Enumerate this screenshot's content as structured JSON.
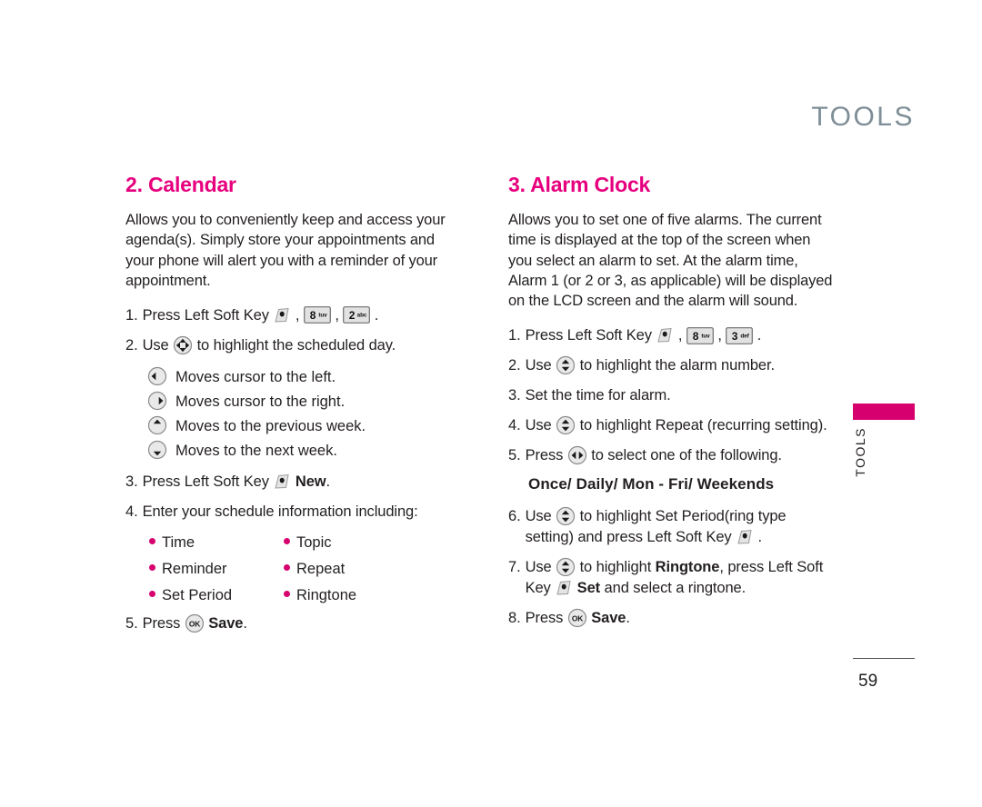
{
  "header": {
    "title": "TOOLS"
  },
  "side_tab": {
    "label": "TOOLS",
    "color": "#d6006e"
  },
  "footer": {
    "page_number": "59"
  },
  "colors": {
    "heading": "#e6007e",
    "bullet": "#d6006e",
    "header_text": "#7d8e96"
  },
  "left_column": {
    "title": "2. Calendar",
    "intro": "Allows you to conveniently keep and access your agenda(s). Simply store your appointments and your phone will alert you with a reminder of your appointment.",
    "steps": [
      {
        "num": "1.",
        "parts": [
          {
            "type": "text",
            "value": "Press Left Soft Key "
          },
          {
            "type": "icon",
            "icon": "soft-key-icon"
          },
          {
            "type": "text",
            "value": " , "
          },
          {
            "type": "key",
            "digit": "8",
            "letters": "tuv"
          },
          {
            "type": "text",
            "value": " , "
          },
          {
            "type": "key",
            "digit": "2",
            "letters": "abc"
          },
          {
            "type": "text",
            "value": " ."
          }
        ]
      },
      {
        "num": "2.",
        "parts": [
          {
            "type": "text",
            "value": "Use "
          },
          {
            "type": "icon",
            "icon": "nav-4way-icon"
          },
          {
            "type": "text",
            "value": " to highlight the scheduled day."
          }
        ]
      }
    ],
    "nav_list": [
      {
        "icon": "nav-left-icon",
        "label": "Moves cursor to the left."
      },
      {
        "icon": "nav-right-icon",
        "label": "Moves cursor to the right."
      },
      {
        "icon": "nav-up-icon",
        "label": "Moves to the previous week."
      },
      {
        "icon": "nav-down-icon",
        "label": "Moves to the next week."
      }
    ],
    "step3": {
      "num": "3.",
      "parts": [
        {
          "type": "text",
          "value": "Press Left Soft Key "
        },
        {
          "type": "icon",
          "icon": "soft-key-icon"
        },
        {
          "type": "text",
          "value": " "
        },
        {
          "type": "bold",
          "value": "New"
        },
        {
          "type": "text",
          "value": "."
        }
      ]
    },
    "step4": {
      "num": "4.",
      "parts": [
        {
          "type": "text",
          "value": "Enter your schedule information including:"
        }
      ]
    },
    "bullets": [
      "Time",
      "Topic",
      "Reminder",
      "Repeat",
      "Set Period",
      "Ringtone"
    ],
    "step5": {
      "num": "5.",
      "parts": [
        {
          "type": "text",
          "value": "Press "
        },
        {
          "type": "icon",
          "icon": "ok-key-icon"
        },
        {
          "type": "text",
          "value": " "
        },
        {
          "type": "bold",
          "value": "Save"
        },
        {
          "type": "text",
          "value": "."
        }
      ]
    }
  },
  "right_column": {
    "title": "3. Alarm Clock",
    "intro": "Allows you to set one of five alarms. The current time is displayed at the top of the screen when you select an alarm to set. At the alarm time, Alarm 1 (or 2 or 3, as applicable) will be displayed on the LCD screen and the alarm will sound.",
    "emphasis_line": "Once/ Daily/ Mon - Fri/ Weekends",
    "steps": [
      {
        "num": "1.",
        "parts": [
          {
            "type": "text",
            "value": "Press Left Soft Key "
          },
          {
            "type": "icon",
            "icon": "soft-key-icon"
          },
          {
            "type": "text",
            "value": " , "
          },
          {
            "type": "key",
            "digit": "8",
            "letters": "tuv"
          },
          {
            "type": "text",
            "value": " , "
          },
          {
            "type": "key",
            "digit": "3",
            "letters": "def"
          },
          {
            "type": "text",
            "value": " ."
          }
        ]
      },
      {
        "num": "2.",
        "parts": [
          {
            "type": "text",
            "value": "Use "
          },
          {
            "type": "icon",
            "icon": "nav-updown-icon"
          },
          {
            "type": "text",
            "value": " to highlight the alarm number."
          }
        ]
      },
      {
        "num": "3.",
        "parts": [
          {
            "type": "text",
            "value": "Set the time for alarm."
          }
        ]
      },
      {
        "num": "4.",
        "parts": [
          {
            "type": "text",
            "value": "Use "
          },
          {
            "type": "icon",
            "icon": "nav-updown-icon"
          },
          {
            "type": "text",
            "value": " to highlight Repeat (recurring setting)."
          }
        ]
      },
      {
        "num": "5.",
        "parts": [
          {
            "type": "text",
            "value": "Press "
          },
          {
            "type": "icon",
            "icon": "nav-leftright-icon"
          },
          {
            "type": "text",
            "value": " to select one of the following."
          }
        ]
      }
    ],
    "steps_after": [
      {
        "num": "6.",
        "parts": [
          {
            "type": "text",
            "value": "Use "
          },
          {
            "type": "icon",
            "icon": "nav-updown-icon"
          },
          {
            "type": "text",
            "value": " to highlight Set Period(ring type setting) and press Left Soft Key "
          },
          {
            "type": "icon",
            "icon": "soft-key-icon"
          },
          {
            "type": "text",
            "value": " ."
          }
        ]
      },
      {
        "num": "7.",
        "parts": [
          {
            "type": "text",
            "value": "Use "
          },
          {
            "type": "icon",
            "icon": "nav-updown-icon"
          },
          {
            "type": "text",
            "value": " to highlight "
          },
          {
            "type": "bold",
            "value": "Ringtone"
          },
          {
            "type": "text",
            "value": ", press Left Soft Key "
          },
          {
            "type": "icon",
            "icon": "soft-key-icon"
          },
          {
            "type": "text",
            "value": " "
          },
          {
            "type": "bold",
            "value": "Set"
          },
          {
            "type": "text",
            "value": " and select a ringtone."
          }
        ]
      },
      {
        "num": "8.",
        "parts": [
          {
            "type": "text",
            "value": "Press "
          },
          {
            "type": "icon",
            "icon": "ok-key-icon"
          },
          {
            "type": "text",
            "value": " "
          },
          {
            "type": "bold",
            "value": "Save"
          },
          {
            "type": "text",
            "value": "."
          }
        ]
      }
    ]
  }
}
